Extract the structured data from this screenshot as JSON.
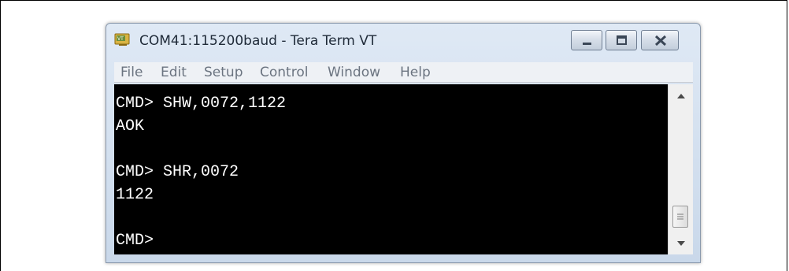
{
  "window": {
    "title": "COM41:115200baud - Tera Term VT"
  },
  "menu": [
    {
      "label": "File"
    },
    {
      "label": "Edit"
    },
    {
      "label": "Setup"
    },
    {
      "label": "Control"
    },
    {
      "label": "Window"
    },
    {
      "label": "Help"
    }
  ],
  "terminal": {
    "lines": [
      "CMD> SHW,0072,1122",
      "AOK",
      "",
      "CMD> SHR,0072",
      "1122",
      "",
      "CMD>"
    ]
  },
  "icons": {
    "app": "tera-term-app-icon",
    "minimize": "minimize-icon",
    "maximize": "maximize-icon",
    "close": "close-icon",
    "scroll_up": "scroll-up-arrow-icon",
    "scroll_down": "scroll-down-arrow-icon"
  },
  "colors": {
    "terminal_bg": "#000000",
    "terminal_fg": "#ffffff",
    "titlebar": "#c9d8ea"
  }
}
